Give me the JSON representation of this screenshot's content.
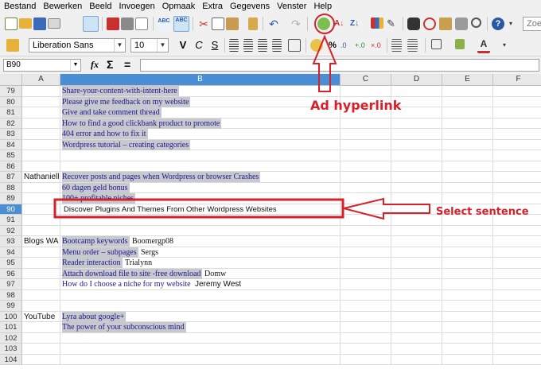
{
  "menu": [
    "Bestand",
    "Bewerken",
    "Beeld",
    "Invoegen",
    "Opmaak",
    "Extra",
    "Gegevens",
    "Venster",
    "Help"
  ],
  "toolbar": {
    "search_placeholder": "Zoek"
  },
  "format_bar": {
    "font_name": "Liberation Sans",
    "font_size": "10",
    "bold": "V",
    "italic": "C",
    "underline": "S"
  },
  "formula_bar": {
    "cell_ref": "B90",
    "fx": "fx",
    "sum": "Σ",
    "equals": "=",
    "value": ""
  },
  "columns": [
    "A",
    "B",
    "C",
    "D",
    "E",
    "F"
  ],
  "rows": [
    {
      "num": "79",
      "a": "",
      "b": "Share-your-content-with-intent-here",
      "b_extra": ""
    },
    {
      "num": "80",
      "a": "",
      "b": "Please give me feedback on my website",
      "b_extra": ""
    },
    {
      "num": "81",
      "a": "",
      "b": "Give and take comment thread",
      "b_extra": ""
    },
    {
      "num": "82",
      "a": "",
      "b": "How to find a good clickbank product to promote",
      "b_extra": ""
    },
    {
      "num": "83",
      "a": "",
      "b": "404 error and how to fix it",
      "b_extra": ""
    },
    {
      "num": "84",
      "a": "",
      "b": "Wordpress tutorial – creating categories",
      "b_extra": ""
    },
    {
      "num": "85",
      "a": "",
      "b": "",
      "b_extra": ""
    },
    {
      "num": "86",
      "a": "",
      "b": "",
      "b_extra": ""
    },
    {
      "num": "87",
      "a": "Nathaniell",
      "b": "Recover posts and pages when Wordpress or browser Crashes",
      "b_extra": ""
    },
    {
      "num": "88",
      "a": "",
      "b": "60 dagen geld bonus",
      "b_extra": ""
    },
    {
      "num": "89",
      "a": "",
      "b": "100+ profitable niches",
      "b_extra": ""
    },
    {
      "num": "90",
      "a": "",
      "b": "Discover Plugins And Themes From Other Wordpress Websites",
      "b_extra": ""
    },
    {
      "num": "91",
      "a": "",
      "b": "",
      "b_extra": ""
    },
    {
      "num": "92",
      "a": "",
      "b": "",
      "b_extra": ""
    },
    {
      "num": "93",
      "a": "Blogs WA",
      "b": "Bootcamp keywords",
      "b_extra": "Boomergp08"
    },
    {
      "num": "94",
      "a": "",
      "b": "Menu order – subpages",
      "b_extra": "Sergs"
    },
    {
      "num": "95",
      "a": "",
      "b": "Reader interaction",
      "b_extra": "Trialynn"
    },
    {
      "num": "96",
      "a": "",
      "b": "Attach download file to site -free download",
      "b_extra": "Domw"
    },
    {
      "num": "97",
      "a": "",
      "b": "How do I choose a niche for my website",
      "b_extra": "Jeremy West"
    },
    {
      "num": "98",
      "a": "",
      "b": "",
      "b_extra": ""
    },
    {
      "num": "99",
      "a": "",
      "b": "",
      "b_extra": ""
    },
    {
      "num": "100",
      "a": "YouTube",
      "b": "Lyra about google+",
      "b_extra": ""
    },
    {
      "num": "101",
      "a": "",
      "b": "The power of your subconscious mind",
      "b_extra": ""
    },
    {
      "num": "102",
      "a": "",
      "b": "",
      "b_extra": ""
    },
    {
      "num": "103",
      "a": "",
      "b": "",
      "b_extra": ""
    },
    {
      "num": "104",
      "a": "",
      "b": "",
      "b_extra": ""
    }
  ],
  "annotations": {
    "hyperlink_label": "Ad hyperlink",
    "select_label": "Select sentence"
  },
  "colors": {
    "accent_red": "#d6212b",
    "selection_blue": "#4a8fd6"
  }
}
